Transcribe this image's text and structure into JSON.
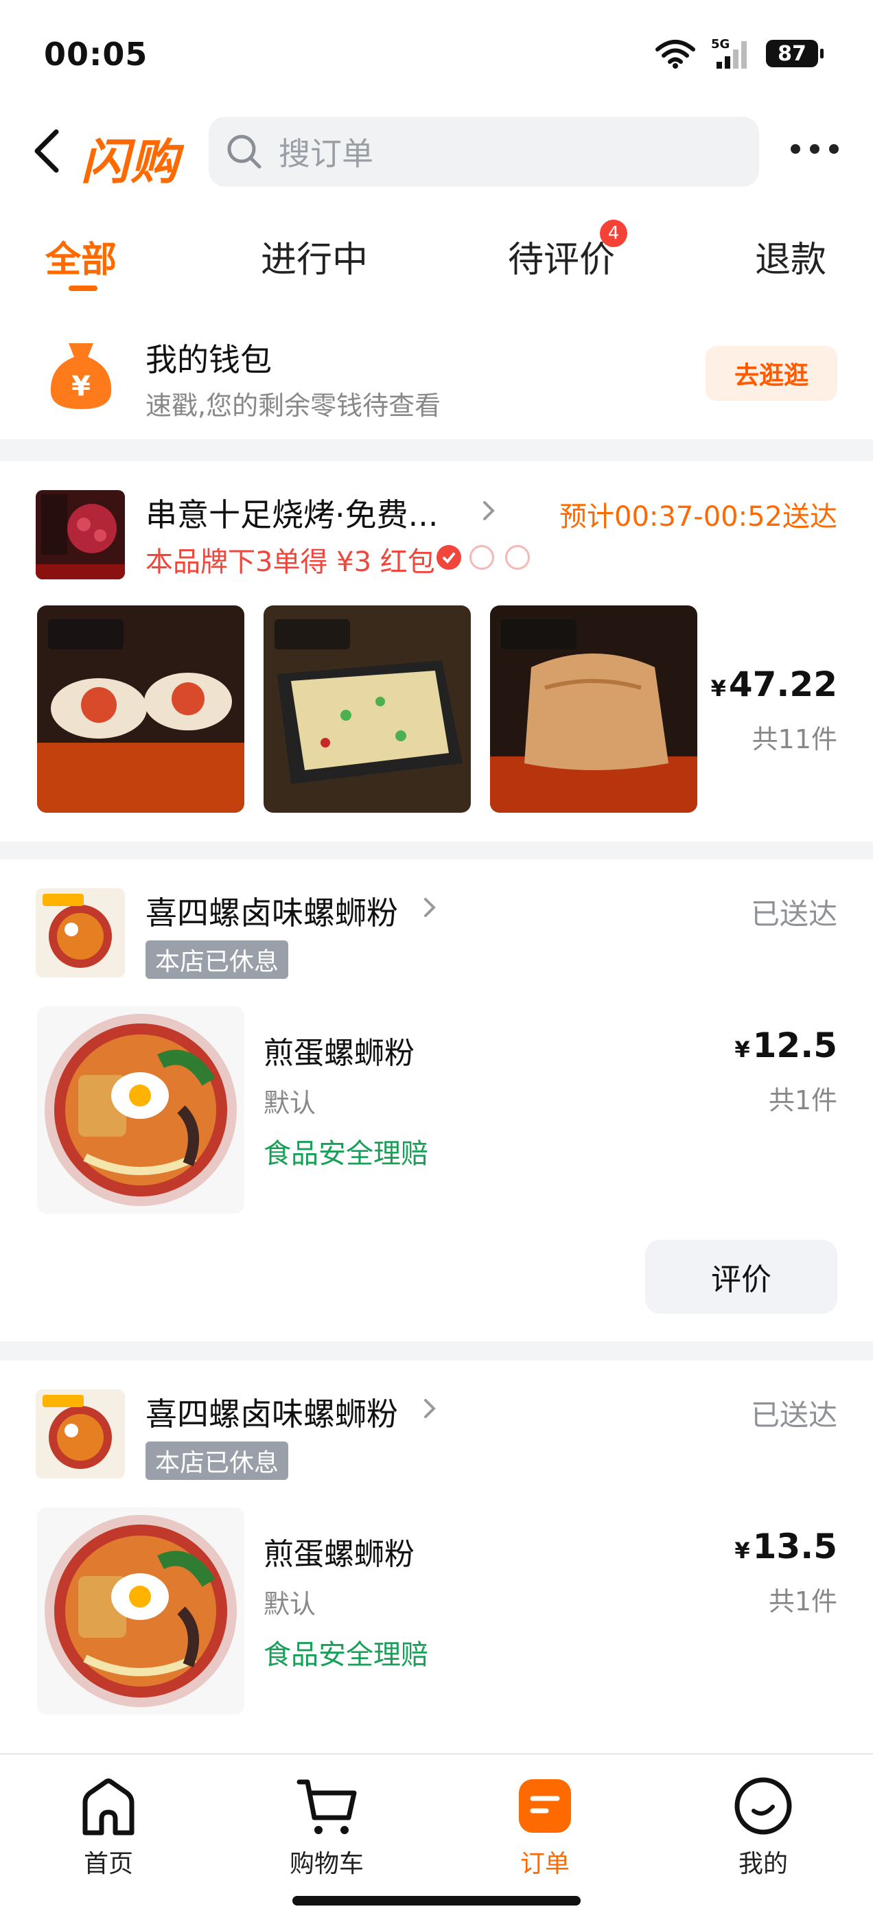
{
  "status_bar": {
    "time": "00:05",
    "network": "5G",
    "battery": "87"
  },
  "header": {
    "logo": "闪购",
    "search_placeholder": "搜订单"
  },
  "tabs": [
    {
      "label": "全部",
      "active": true
    },
    {
      "label": "进行中"
    },
    {
      "label": "待评价",
      "badge": "4"
    },
    {
      "label": "退款"
    }
  ],
  "wallet": {
    "title": "我的钱包",
    "subtitle": "速戳,您的剩余零钱待查看",
    "button": "去逛逛"
  },
  "orders": [
    {
      "store": "串意十足烧烤·免费...",
      "status": "预计00:37-00:52送达",
      "promo": "本品牌下3单得 ¥3 红包",
      "price_symbol": "¥",
      "price": "47.22",
      "count": "共11件"
    },
    {
      "store": "喜四螺卤味螺蛳粉",
      "status": "已送达",
      "tag": "本店已休息",
      "item": "煎蛋螺蛳粉",
      "spec": "默认",
      "safety": "食品安全理赔",
      "price_symbol": "¥",
      "price": "12.5",
      "count": "共1件",
      "action": "评价"
    },
    {
      "store": "喜四螺卤味螺蛳粉",
      "status": "已送达",
      "tag": "本店已休息",
      "item": "煎蛋螺蛳粉",
      "spec": "默认",
      "safety": "食品安全理赔",
      "price_symbol": "¥",
      "price": "13.5",
      "count": "共1件"
    }
  ],
  "nav": [
    {
      "label": "首页",
      "icon": "home-icon"
    },
    {
      "label": "购物车",
      "icon": "cart-icon"
    },
    {
      "label": "订单",
      "icon": "order-icon",
      "active": true
    },
    {
      "label": "我的",
      "icon": "profile-icon"
    }
  ],
  "colors": {
    "accent": "#ff6a00",
    "promo_red": "#f0463c",
    "safety_green": "#18a058"
  }
}
